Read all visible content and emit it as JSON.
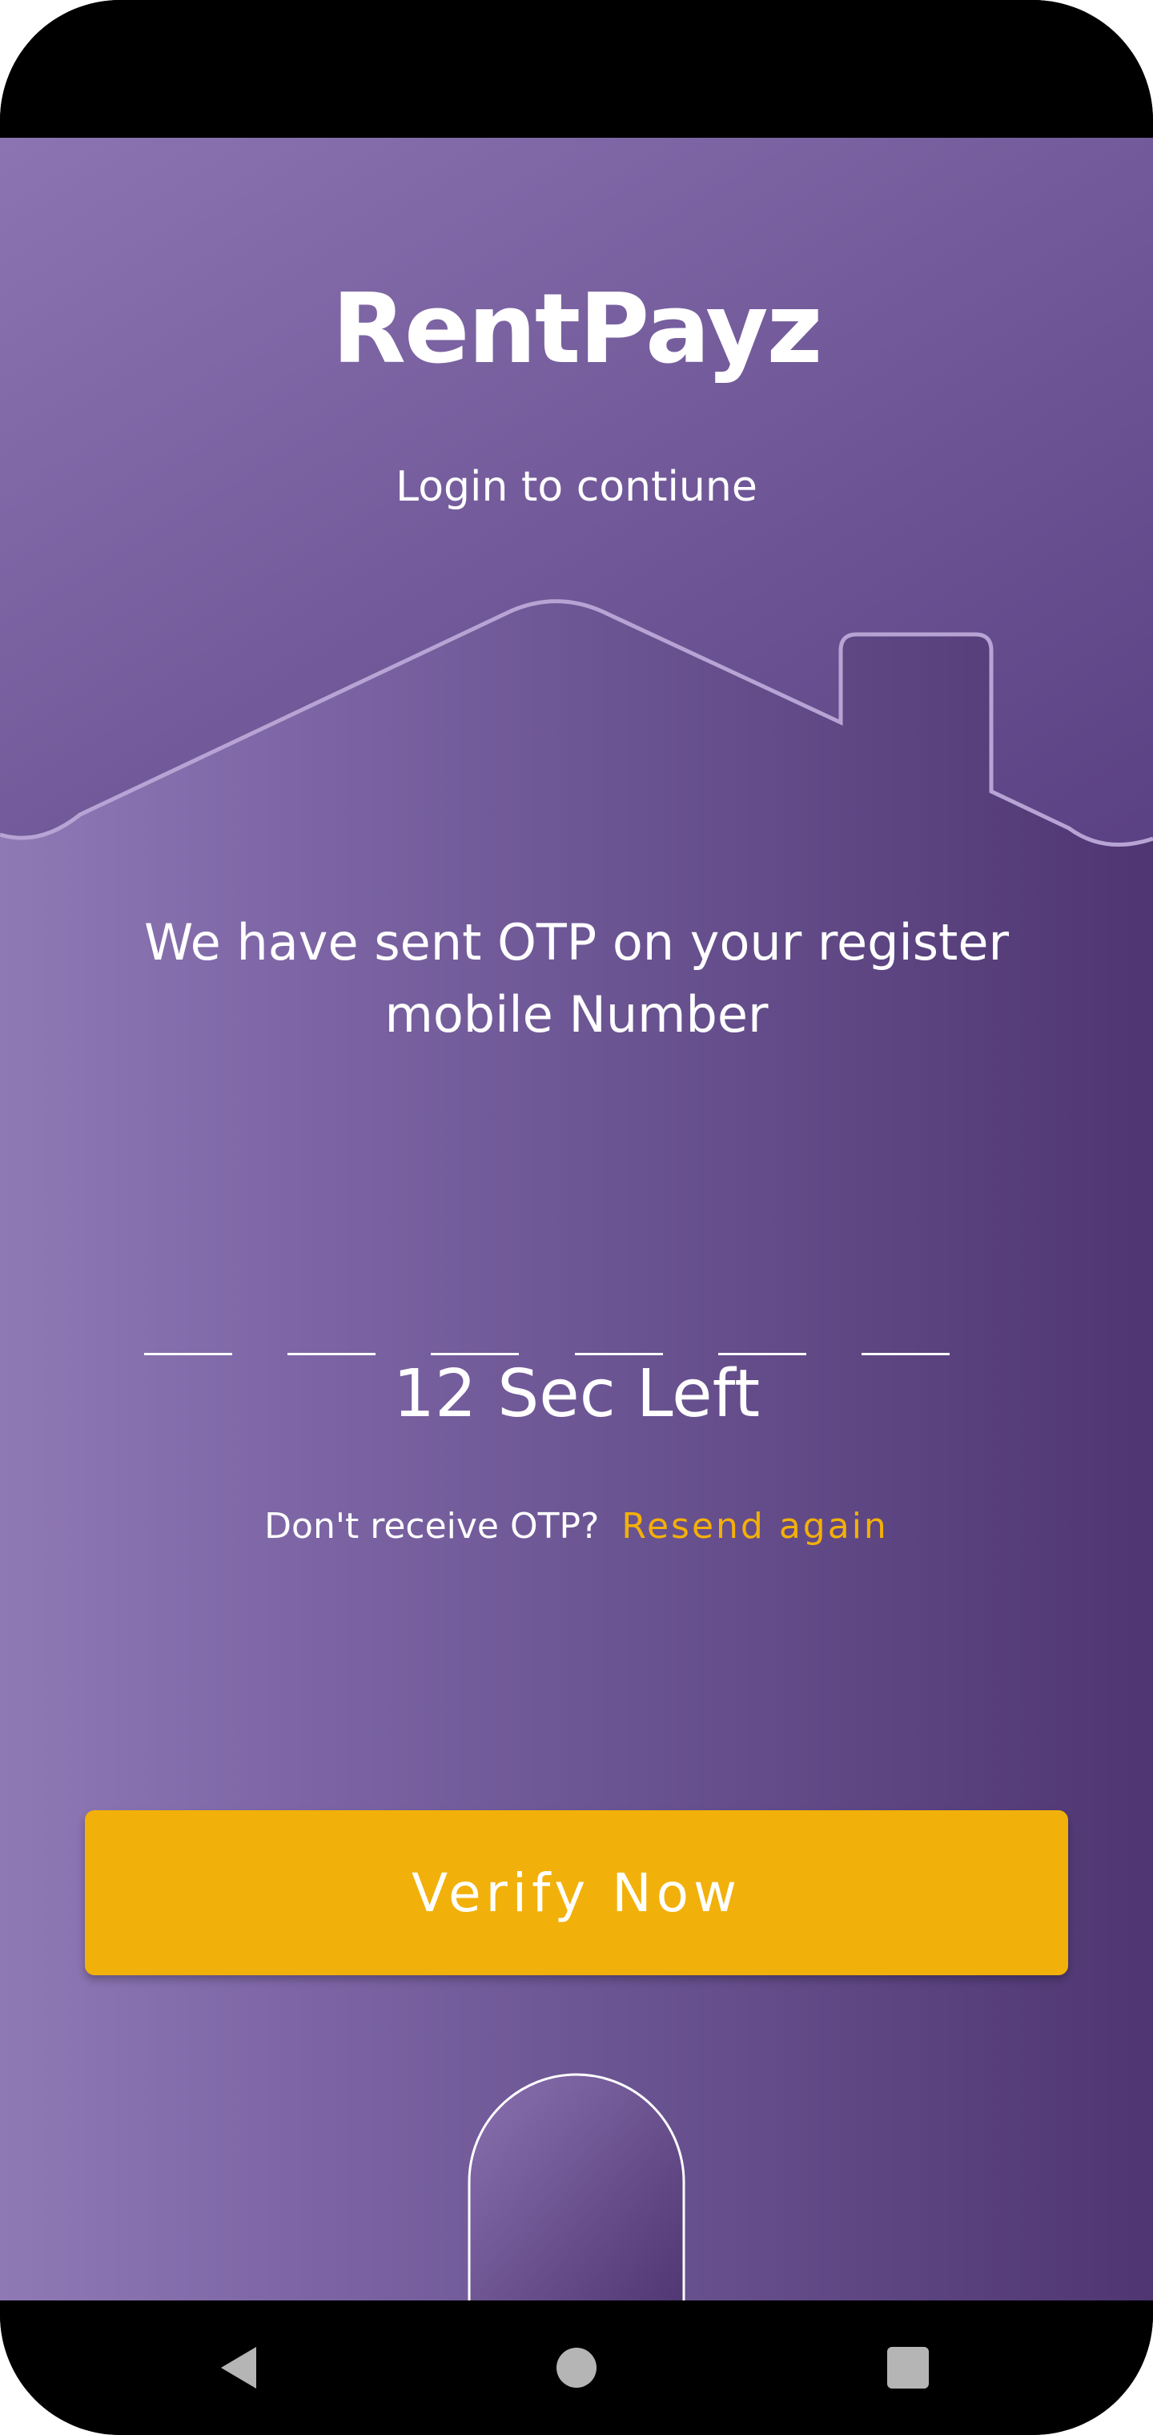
{
  "app": {
    "title": "RentPayz",
    "subtitle": "Login to contiune"
  },
  "otp": {
    "message": "We have sent OTP on your register mobile Number",
    "slots": [
      "",
      "",
      "",
      "",
      "",
      ""
    ],
    "timer": "12 Sec Left",
    "resend_label": "Don't receive OTP?",
    "resend_link": "Resend again"
  },
  "actions": {
    "verify_label": "Verify Now"
  },
  "system_nav": {
    "back_icon": "back-triangle-icon",
    "home_icon": "home-circle-icon",
    "recents_icon": "recents-square-icon"
  },
  "colors": {
    "gradient_start": "#8f79b5",
    "gradient_end": "#4f3672",
    "accent": "#f2b00a",
    "text": "#ffffff"
  }
}
